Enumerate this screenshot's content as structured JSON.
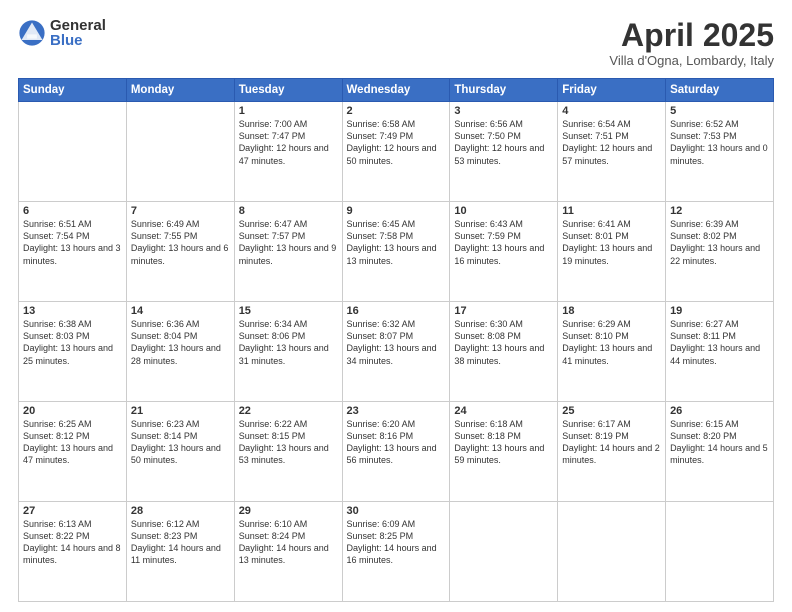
{
  "logo": {
    "general": "General",
    "blue": "Blue"
  },
  "title": "April 2025",
  "location": "Villa d'Ogna, Lombardy, Italy",
  "headers": [
    "Sunday",
    "Monday",
    "Tuesday",
    "Wednesday",
    "Thursday",
    "Friday",
    "Saturday"
  ],
  "weeks": [
    [
      {
        "day": "",
        "info": ""
      },
      {
        "day": "",
        "info": ""
      },
      {
        "day": "1",
        "info": "Sunrise: 7:00 AM\nSunset: 7:47 PM\nDaylight: 12 hours and 47 minutes."
      },
      {
        "day": "2",
        "info": "Sunrise: 6:58 AM\nSunset: 7:49 PM\nDaylight: 12 hours and 50 minutes."
      },
      {
        "day": "3",
        "info": "Sunrise: 6:56 AM\nSunset: 7:50 PM\nDaylight: 12 hours and 53 minutes."
      },
      {
        "day": "4",
        "info": "Sunrise: 6:54 AM\nSunset: 7:51 PM\nDaylight: 12 hours and 57 minutes."
      },
      {
        "day": "5",
        "info": "Sunrise: 6:52 AM\nSunset: 7:53 PM\nDaylight: 13 hours and 0 minutes."
      }
    ],
    [
      {
        "day": "6",
        "info": "Sunrise: 6:51 AM\nSunset: 7:54 PM\nDaylight: 13 hours and 3 minutes."
      },
      {
        "day": "7",
        "info": "Sunrise: 6:49 AM\nSunset: 7:55 PM\nDaylight: 13 hours and 6 minutes."
      },
      {
        "day": "8",
        "info": "Sunrise: 6:47 AM\nSunset: 7:57 PM\nDaylight: 13 hours and 9 minutes."
      },
      {
        "day": "9",
        "info": "Sunrise: 6:45 AM\nSunset: 7:58 PM\nDaylight: 13 hours and 13 minutes."
      },
      {
        "day": "10",
        "info": "Sunrise: 6:43 AM\nSunset: 7:59 PM\nDaylight: 13 hours and 16 minutes."
      },
      {
        "day": "11",
        "info": "Sunrise: 6:41 AM\nSunset: 8:01 PM\nDaylight: 13 hours and 19 minutes."
      },
      {
        "day": "12",
        "info": "Sunrise: 6:39 AM\nSunset: 8:02 PM\nDaylight: 13 hours and 22 minutes."
      }
    ],
    [
      {
        "day": "13",
        "info": "Sunrise: 6:38 AM\nSunset: 8:03 PM\nDaylight: 13 hours and 25 minutes."
      },
      {
        "day": "14",
        "info": "Sunrise: 6:36 AM\nSunset: 8:04 PM\nDaylight: 13 hours and 28 minutes."
      },
      {
        "day": "15",
        "info": "Sunrise: 6:34 AM\nSunset: 8:06 PM\nDaylight: 13 hours and 31 minutes."
      },
      {
        "day": "16",
        "info": "Sunrise: 6:32 AM\nSunset: 8:07 PM\nDaylight: 13 hours and 34 minutes."
      },
      {
        "day": "17",
        "info": "Sunrise: 6:30 AM\nSunset: 8:08 PM\nDaylight: 13 hours and 38 minutes."
      },
      {
        "day": "18",
        "info": "Sunrise: 6:29 AM\nSunset: 8:10 PM\nDaylight: 13 hours and 41 minutes."
      },
      {
        "day": "19",
        "info": "Sunrise: 6:27 AM\nSunset: 8:11 PM\nDaylight: 13 hours and 44 minutes."
      }
    ],
    [
      {
        "day": "20",
        "info": "Sunrise: 6:25 AM\nSunset: 8:12 PM\nDaylight: 13 hours and 47 minutes."
      },
      {
        "day": "21",
        "info": "Sunrise: 6:23 AM\nSunset: 8:14 PM\nDaylight: 13 hours and 50 minutes."
      },
      {
        "day": "22",
        "info": "Sunrise: 6:22 AM\nSunset: 8:15 PM\nDaylight: 13 hours and 53 minutes."
      },
      {
        "day": "23",
        "info": "Sunrise: 6:20 AM\nSunset: 8:16 PM\nDaylight: 13 hours and 56 minutes."
      },
      {
        "day": "24",
        "info": "Sunrise: 6:18 AM\nSunset: 8:18 PM\nDaylight: 13 hours and 59 minutes."
      },
      {
        "day": "25",
        "info": "Sunrise: 6:17 AM\nSunset: 8:19 PM\nDaylight: 14 hours and 2 minutes."
      },
      {
        "day": "26",
        "info": "Sunrise: 6:15 AM\nSunset: 8:20 PM\nDaylight: 14 hours and 5 minutes."
      }
    ],
    [
      {
        "day": "27",
        "info": "Sunrise: 6:13 AM\nSunset: 8:22 PM\nDaylight: 14 hours and 8 minutes."
      },
      {
        "day": "28",
        "info": "Sunrise: 6:12 AM\nSunset: 8:23 PM\nDaylight: 14 hours and 11 minutes."
      },
      {
        "day": "29",
        "info": "Sunrise: 6:10 AM\nSunset: 8:24 PM\nDaylight: 14 hours and 13 minutes."
      },
      {
        "day": "30",
        "info": "Sunrise: 6:09 AM\nSunset: 8:25 PM\nDaylight: 14 hours and 16 minutes."
      },
      {
        "day": "",
        "info": ""
      },
      {
        "day": "",
        "info": ""
      },
      {
        "day": "",
        "info": ""
      }
    ]
  ]
}
